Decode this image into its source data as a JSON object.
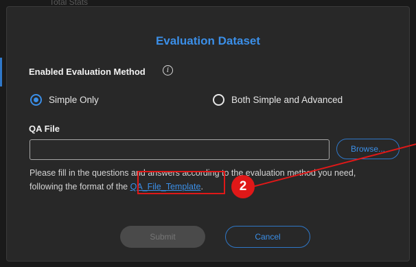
{
  "backdrop": {
    "text": "Total Stats"
  },
  "dialog": {
    "title": "Evaluation Dataset",
    "method_label": "Enabled Evaluation Method",
    "info_icon_glyph": "i",
    "radio_options": [
      {
        "label": "Simple Only",
        "checked": true
      },
      {
        "label": "Both Simple and Advanced",
        "checked": false
      }
    ],
    "qa_file_label": "QA File",
    "qa_file_value": "",
    "browse_label": "Browse...",
    "hint_line1": "Please fill in the questions and answers according to the evaluation method you need,",
    "hint_line2_prefix": "following the format of the ",
    "template_link": "QA_File_Template",
    "hint_line2_suffix": ".",
    "submit_label": "Submit",
    "cancel_label": "Cancel"
  },
  "annotation": {
    "step_number": "2",
    "color": "#e01818"
  },
  "colors": {
    "accent": "#3b8fe8",
    "dialog_bg": "#282828",
    "disabled_button": "#4a4a4a"
  }
}
